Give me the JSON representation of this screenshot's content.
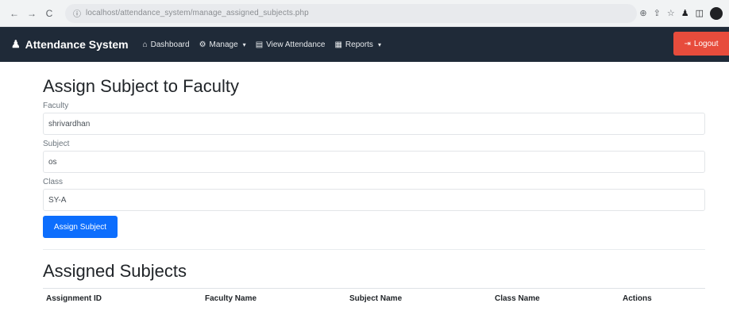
{
  "browser": {
    "url": "localhost/attendance_system/manage_assigned_subjects.php",
    "back_icon": "←",
    "forward_icon": "→",
    "reload_icon": "C",
    "info_icon": "ⓘ",
    "zoom_icon": "⊕",
    "share_icon": "⇪",
    "star_icon": "☆",
    "ext_icon": "♟",
    "tab_icon": "◫"
  },
  "navbar": {
    "brand_icon": "♟",
    "brand": "Attendance System",
    "items": [
      {
        "icon": "⌂",
        "label": "Dashboard",
        "dropdown": false
      },
      {
        "icon": "⚙",
        "label": "Manage",
        "dropdown": true
      },
      {
        "icon": "▤",
        "label": "View Attendance",
        "dropdown": false
      },
      {
        "icon": "▦",
        "label": "Reports",
        "dropdown": true
      }
    ],
    "caret": "▾",
    "logout_icon": "⇥",
    "logout_label": "Logout"
  },
  "form": {
    "title": "Assign Subject to Faculty",
    "faculty_label": "Faculty",
    "faculty_value": "shrivardhan",
    "subject_label": "Subject",
    "subject_value": "os",
    "class_label": "Class",
    "class_value": "SY-A",
    "submit_label": "Assign Subject"
  },
  "assigned": {
    "title": "Assigned Subjects",
    "columns": [
      "Assignment ID",
      "Faculty Name",
      "Subject Name",
      "Class Name",
      "Actions"
    ]
  },
  "colors": {
    "navbar": "#1f2a38",
    "primary": "#0d6efd",
    "danger": "#e74c3c"
  }
}
